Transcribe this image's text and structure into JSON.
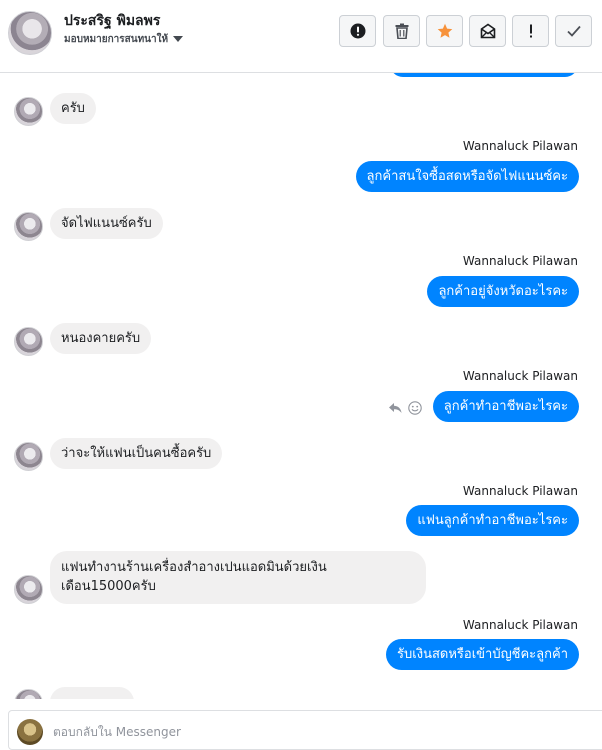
{
  "header": {
    "contact_name": "ประสริฐ พิมลพร",
    "assign_label": "มอบหมายการสนทนาให้"
  },
  "toolbar": {
    "buttons": [
      {
        "name": "mark-spam-button",
        "icon": "exclamation-circle-icon"
      },
      {
        "name": "delete-button",
        "icon": "trash-icon"
      },
      {
        "name": "star-button",
        "icon": "star-icon",
        "color": "#f7923b"
      },
      {
        "name": "mark-unread-button",
        "icon": "open-envelope-icon"
      },
      {
        "name": "follow-up-button",
        "icon": "exclamation-icon"
      },
      {
        "name": "mark-done-button",
        "icon": "checkmark-icon"
      }
    ]
  },
  "colors": {
    "outgoing_bubble": "#0084ff",
    "incoming_bubble": "#f1f0f0"
  },
  "messages": [
    {
      "direction": "in",
      "text": "ครับ"
    },
    {
      "direction": "out",
      "sender": "Wannaluck Pilawan",
      "text": "ลูกค้าสนใจซื้อสดหรือจัดไฟแนนซ์คะ"
    },
    {
      "direction": "in",
      "text": "จัดไฟแนนซ์ครับ"
    },
    {
      "direction": "out",
      "sender": "Wannaluck Pilawan",
      "text": "ลูกค้าอยู่จังหวัดอะไรคะ"
    },
    {
      "direction": "in",
      "text": "หนองคายครับ"
    },
    {
      "direction": "out",
      "sender": "Wannaluck Pilawan",
      "text": "ลูกค้าทำอาชีพอะไรคะ"
    },
    {
      "direction": "in",
      "text": "ว่าจะให้แฟนเป็นคนซื้อครับ"
    },
    {
      "direction": "out",
      "sender": "Wannaluck Pilawan",
      "text": "แฟนลูกค้าทำอาชีพอะไรคะ"
    },
    {
      "direction": "in",
      "text_line1": "แฟนทำงานร้านเครื่องสำอางเปนแอดมินด้วยเงิน",
      "text_line2": "เดือน15000ครับ"
    },
    {
      "direction": "out",
      "sender": "Wannaluck Pilawan",
      "text": "รับเงินสดหรือเข้าบัญชีคะลูกค้า"
    }
  ],
  "composer": {
    "placeholder": "ตอบกลับใน Messenger"
  }
}
